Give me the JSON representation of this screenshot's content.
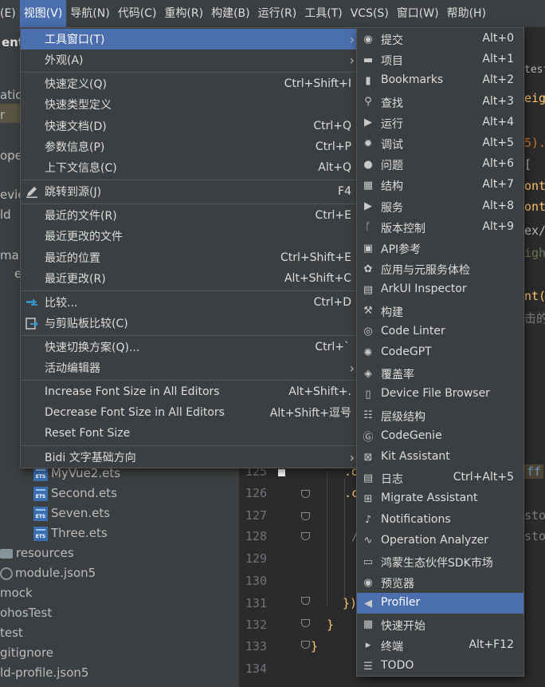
{
  "menubar": {
    "items": [
      "(E)",
      "视图(V)",
      "导航(N)",
      "代码(C)",
      "重构(R)",
      "构建(B)",
      "运行(R)",
      "工具(T)",
      "VCS(S)",
      "窗口(W)",
      "帮助(H)"
    ]
  },
  "left_fragments": [
    "ent",
    "atio",
    "r",
    "ope",
    "evie",
    "ld",
    "mai",
    "e"
  ],
  "tree": {
    "files": [
      "MyVue2.ets",
      "Second.ets",
      "Seven.ets",
      "Three.ets"
    ],
    "folder_resources": "resources",
    "module_json": "module.json5",
    "mock": "mock",
    "ohos_test": "ohosTest",
    "test": "test",
    "gitignore": "gitignore",
    "build_profile": "ld-profile.json5"
  },
  "editor": {
    "line_numbers": [
      "125",
      "126",
      "127",
      "128",
      "129",
      "130",
      "131",
      "132",
      "133",
      "134"
    ],
    "frag_test": "test",
    "frag_eigh": "eigh",
    "frag_paren": "5).c",
    "frag_bracket": "[",
    "frag_font1": "ont",
    "frag_font2": "ont",
    "frag_ex": "ex/",
    "frag_ight": "ight",
    "frag_nt": "nt(",
    "frag_cn": "击的",
    "frag_ff": "ff",
    "frag_stop1": "stop",
    "frag_stop2": "stop",
    "frag_d": ".d",
    "frag_c": ".c",
    "frag_slash": "/",
    "frag_close1": "})",
    "frag_close2": "}",
    "frag_close3": "}"
  },
  "view_menu": {
    "items": [
      {
        "label": "工具窗口(T)",
        "shortcut": "",
        "arrow": true,
        "selected": true
      },
      {
        "label": "外观(A)",
        "shortcut": "",
        "arrow": true
      },
      {
        "label": "快速定义(Q)",
        "shortcut": "Ctrl+Shift+I"
      },
      {
        "label": "快速类型定义",
        "shortcut": ""
      },
      {
        "label": "快速文档(D)",
        "shortcut": "Ctrl+Q"
      },
      {
        "label": "参数信息(P)",
        "shortcut": "Ctrl+P"
      },
      {
        "label": "上下文信息(C)",
        "shortcut": "Alt+Q"
      },
      {
        "label": "跳转到源(J)",
        "shortcut": "F4",
        "icon": "pencil-icon"
      },
      {
        "label": "最近的文件(R)",
        "shortcut": "Ctrl+E"
      },
      {
        "label": "最近更改的文件",
        "shortcut": ""
      },
      {
        "label": "最近的位置",
        "shortcut": "Ctrl+Shift+E"
      },
      {
        "label": "最近更改(R)",
        "shortcut": "Alt+Shift+C"
      },
      {
        "label": "比较...",
        "shortcut": "Ctrl+D",
        "icon": "compare-icon"
      },
      {
        "label": "与剪贴板比较(C)",
        "shortcut": "",
        "icon": "clipboard-compare-icon"
      },
      {
        "label": "快速切换方案(Q)...",
        "shortcut": "Ctrl+`"
      },
      {
        "label": "活动编辑器",
        "shortcut": "",
        "arrow": true
      },
      {
        "label": "Increase Font Size in All Editors",
        "shortcut": "Alt+Shift+."
      },
      {
        "label": "Decrease Font Size in All Editors",
        "shortcut": "Alt+Shift+逗号"
      },
      {
        "label": "Reset Font Size",
        "shortcut": ""
      },
      {
        "label": "Bidi 文字基础方向",
        "shortcut": "",
        "arrow": true
      }
    ]
  },
  "tools_submenu": {
    "items": [
      {
        "label": "提交",
        "shortcut": "Alt+0",
        "icon": "commit-icon"
      },
      {
        "label": "项目",
        "shortcut": "Alt+1",
        "icon": "folder-icon"
      },
      {
        "label": "Bookmarks",
        "shortcut": "Alt+2",
        "icon": "bookmark-icon"
      },
      {
        "label": "查找",
        "shortcut": "Alt+3",
        "icon": "search-icon"
      },
      {
        "label": "运行",
        "shortcut": "Alt+4",
        "icon": "run-icon"
      },
      {
        "label": "调试",
        "shortcut": "Alt+5",
        "icon": "bug-icon"
      },
      {
        "label": "问题",
        "shortcut": "Alt+6",
        "icon": "warning-icon"
      },
      {
        "label": "结构",
        "shortcut": "Alt+7",
        "icon": "structure-icon"
      },
      {
        "label": "服务",
        "shortcut": "Alt+8",
        "icon": "services-icon"
      },
      {
        "label": "版本控制",
        "shortcut": "Alt+9",
        "icon": "vcs-branch-icon"
      },
      {
        "label": "API参考",
        "shortcut": "",
        "icon": "api-icon"
      },
      {
        "label": "应用与元服务体检",
        "shortcut": "",
        "icon": "checkup-icon"
      },
      {
        "label": "ArkUI Inspector",
        "shortcut": "",
        "icon": "inspector-icon"
      },
      {
        "label": "构建",
        "shortcut": "",
        "icon": "hammer-icon"
      },
      {
        "label": "Code Linter",
        "shortcut": "",
        "icon": "linter-icon"
      },
      {
        "label": "CodeGPT",
        "shortcut": "",
        "icon": "codegpt-icon"
      },
      {
        "label": "覆盖率",
        "shortcut": "",
        "icon": "shield-icon"
      },
      {
        "label": "Device File Browser",
        "shortcut": "",
        "icon": "device-icon"
      },
      {
        "label": "层级结构",
        "shortcut": "",
        "icon": "hierarchy-icon"
      },
      {
        "label": "CodeGenie",
        "shortcut": "",
        "icon": "codegenie-icon"
      },
      {
        "label": "Kit Assistant",
        "shortcut": "",
        "icon": "kit-icon"
      },
      {
        "label": "日志",
        "shortcut": "Ctrl+Alt+5",
        "icon": "log-icon"
      },
      {
        "label": "Migrate Assistant",
        "shortcut": "",
        "icon": "migrate-icon"
      },
      {
        "label": "Notifications",
        "shortcut": "",
        "icon": "bell-icon"
      },
      {
        "label": "Operation Analyzer",
        "shortcut": "",
        "icon": "chart-icon"
      },
      {
        "label": "鸿蒙生态伙伴SDK市场",
        "shortcut": "",
        "icon": "sdk-icon"
      },
      {
        "label": "预览器",
        "shortcut": "",
        "icon": "eye-icon"
      },
      {
        "label": "Profiler",
        "shortcut": "",
        "icon": "profiler-icon",
        "selected": true
      },
      {
        "label": "快速开始",
        "shortcut": "",
        "icon": "quickstart-icon"
      },
      {
        "label": "终端",
        "shortcut": "Alt+F12",
        "icon": "terminal-icon"
      },
      {
        "label": "TODO",
        "shortcut": "",
        "icon": "todo-icon"
      }
    ],
    "glyphs": {
      "commit-icon": "◉",
      "folder-icon": "▬",
      "bookmark-icon": "▮",
      "search-icon": "⚲",
      "run-icon": "▶",
      "bug-icon": "✹",
      "warning-icon": "●",
      "structure-icon": "▦",
      "services-icon": "▶",
      "vcs-branch-icon": "ᚴ",
      "api-icon": "▣",
      "checkup-icon": "✿",
      "inspector-icon": "▤",
      "hammer-icon": "⚒",
      "linter-icon": "◎",
      "codegpt-icon": "✺",
      "shield-icon": "◈",
      "device-icon": "▯",
      "hierarchy-icon": "☷",
      "codegenie-icon": "Ⓖ",
      "kit-icon": "⊠",
      "log-icon": "▤",
      "migrate-icon": "⊞",
      "bell-icon": "♪",
      "chart-icon": "∿",
      "sdk-icon": "▭",
      "eye-icon": "◉",
      "profiler-icon": "◀",
      "quickstart-icon": "▦",
      "terminal-icon": "▸",
      "todo-icon": "☰"
    }
  },
  "colors": {
    "selection": "#4b6eaf",
    "menu_bg": "#3c3f41",
    "editor_bg": "#2b2b2b"
  }
}
